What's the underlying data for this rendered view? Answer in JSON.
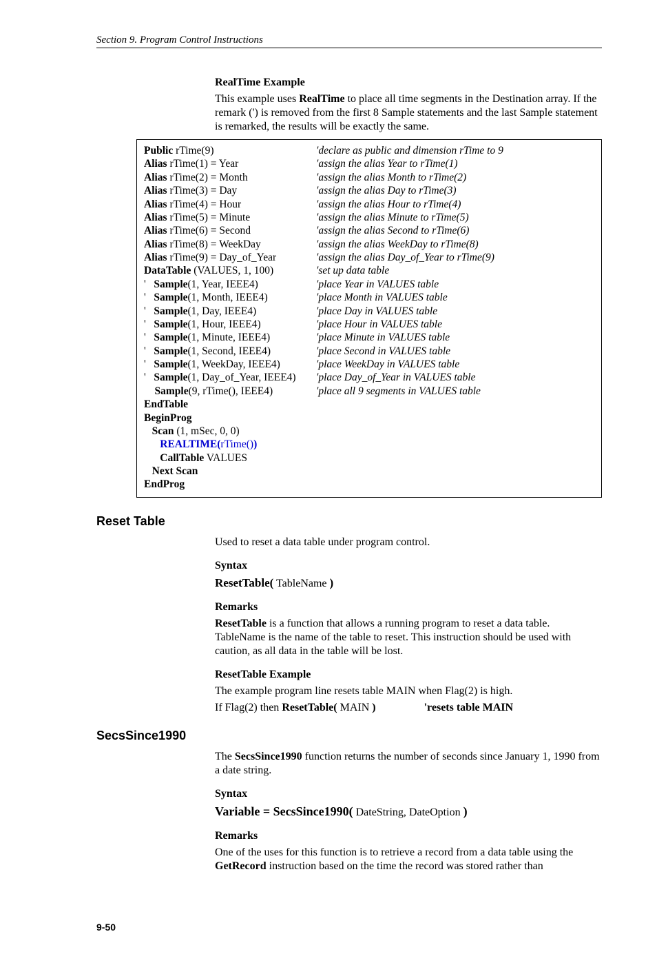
{
  "header": "Section 9.  Program Control Instructions",
  "realtime": {
    "title": "RealTime Example",
    "desc_parts": [
      "This example uses ",
      "RealTime",
      " to place all time segments in the Destination array.  If the remark (') is removed from the first 8 Sample statements and the last Sample statement is remarked, the results will be exactly the same."
    ]
  },
  "code": [
    {
      "l_pre": "",
      "l_bold": "Public",
      "l_post": " rTime(9)",
      "r": "'declare as public and dimension rTime to 9"
    },
    {
      "l_pre": "",
      "l_bold": "Alias",
      "l_post": " rTime(1) = Year",
      "r": "'assign the alias Year to rTime(1)"
    },
    {
      "l_pre": "",
      "l_bold": "Alias",
      "l_post": " rTime(2) = Month",
      "r": "'assign the alias Month to rTime(2)"
    },
    {
      "l_pre": "",
      "l_bold": "Alias",
      "l_post": " rTime(3) = Day",
      "r": "'assign the alias Day to rTime(3)"
    },
    {
      "l_pre": "",
      "l_bold": "Alias",
      "l_post": " rTime(4) = Hour",
      "r": "'assign the alias Hour to rTime(4)"
    },
    {
      "l_pre": "",
      "l_bold": "Alias",
      "l_post": " rTime(5) = Minute",
      "r": "'assign the alias Minute to rTime(5)"
    },
    {
      "l_pre": "",
      "l_bold": "Alias",
      "l_post": " rTime(6) = Second",
      "r": "'assign the alias Second to rTime(6)"
    },
    {
      "l_pre": "",
      "l_bold": "Alias",
      "l_post": " rTime(8) = WeekDay",
      "r": "'assign the alias WeekDay to rTime(8)"
    },
    {
      "l_pre": "",
      "l_bold": "Alias",
      "l_post": " rTime(9) = Day_of_Year",
      "r": "'assign the alias Day_of_Year to rTime(9)"
    },
    {
      "l_pre": "",
      "l_bold": "DataTable",
      "l_post": " (VALUES, 1, 100)",
      "r": "'set up data table"
    },
    {
      "l_pre": "'   ",
      "l_bold": "Sample",
      "l_post": "(1, Year, IEEE4)",
      "r": "'place Year in VALUES table"
    },
    {
      "l_pre": "'   ",
      "l_bold": "Sample",
      "l_post": "(1, Month, IEEE4)",
      "r": "'place Month in VALUES table"
    },
    {
      "l_pre": "'   ",
      "l_bold": "Sample",
      "l_post": "(1, Day, IEEE4)",
      "r": "'place Day in VALUES table"
    },
    {
      "l_pre": "'   ",
      "l_bold": "Sample",
      "l_post": "(1, Hour, IEEE4)",
      "r": "'place Hour in VALUES table"
    },
    {
      "l_pre": "'   ",
      "l_bold": "Sample",
      "l_post": "(1, Minute, IEEE4)",
      "r": "'place Minute in VALUES table"
    },
    {
      "l_pre": "'   ",
      "l_bold": "Sample",
      "l_post": "(1, Second, IEEE4)",
      "r": "'place Second in VALUES table"
    },
    {
      "l_pre": "'   ",
      "l_bold": "Sample",
      "l_post": "(1, WeekDay, IEEE4)",
      "r": "'place WeekDay in VALUES table"
    },
    {
      "l_pre": "'   ",
      "l_bold": "Sample",
      "l_post": "(1, Day_of_Year, IEEE4)",
      "r": "'place Day_of_Year in VALUES table"
    },
    {
      "l_pre": "    ",
      "l_bold": "Sample",
      "l_post": "(9, rTime(), IEEE4)",
      "r": "'place all 9 segments in VALUES table"
    },
    {
      "l_pre": "",
      "l_bold": "EndTable",
      "l_post": "",
      "r": ""
    },
    {
      "l_pre": "",
      "l_bold": "BeginProg",
      "l_post": "",
      "r": ""
    }
  ],
  "code_tail": {
    "scan_pre": "   ",
    "scan_bold": "Scan",
    "scan_post": " (1, mSec, 0, 0)",
    "rt_pre": "      ",
    "rt_bold": "REALTIME(",
    "rt_mid": "rTime()",
    "rt_bold2": ")",
    "ct_pre": "      ",
    "ct_bold": "CallTable",
    "ct_post": " VALUES",
    "ns_pre": "   ",
    "ns_bold": "Next Scan",
    "ep_bold": "EndProg"
  },
  "reset": {
    "heading": "Reset Table",
    "intro": "Used to reset a data table under program control.",
    "syntax_label": "Syntax",
    "syntax_fn": "ResetTable(",
    "syntax_arg": " TableName ",
    "syntax_close": ")",
    "remarks_label": "Remarks",
    "remarks_bold": "ResetTable",
    "remarks_text": " is a function that allows a running program to reset a data table. TableName is the name of the table to reset. This instruction should be used with caution, as all data in the table will be lost.",
    "example_title": "ResetTable Example",
    "example_line1": "The example program line resets table MAIN when Flag(2) is high.",
    "example_if": "If Flag(2) then ",
    "example_fn": "ResetTable(",
    "example_arg": " MAIN ",
    "example_close": ")",
    "example_comment": "'resets table MAIN"
  },
  "secs": {
    "heading": "SecsSince1990",
    "intro_pre": " The ",
    "intro_bold": "SecsSince1990",
    "intro_post": " function returns the number of seconds since January 1, 1990 from a date string.",
    "syntax_label": "Syntax",
    "syntax_var": "Variable = SecsSince1990(",
    "syntax_args": " DateString, DateOption ",
    "syntax_close": ")",
    "remarks_label": "Remarks",
    "remarks_pre": "One of the uses for this function is to retrieve a record from a data table using the ",
    "remarks_bold": "GetRecord",
    "remarks_post": " instruction based on the time the record was stored rather than"
  },
  "page_number": "9-50"
}
